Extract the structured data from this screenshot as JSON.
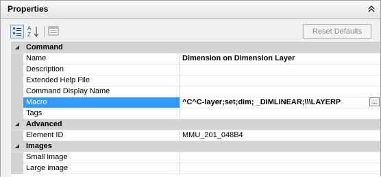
{
  "window": {
    "title": "Properties"
  },
  "toolbar": {
    "categorized_label": "Categorized",
    "alphabetical_label": "Alphabetical",
    "property_pages_label": "Property Pages",
    "reset_label": "Reset Defaults"
  },
  "categories": [
    {
      "label": "Command",
      "rows": [
        {
          "name": "Name",
          "value": "Dimension on Dimension Layer"
        },
        {
          "name": "Description",
          "value": ""
        },
        {
          "name": "Extended Help File",
          "value": ""
        },
        {
          "name": "Command Display Name",
          "value": ""
        },
        {
          "name": "Macro",
          "value": "^C^C-layer;set;dim; _DIMLINEAR;\\\\\\LAYERP"
        },
        {
          "name": "Tags",
          "value": ""
        }
      ]
    },
    {
      "label": "Advanced",
      "rows": [
        {
          "name": "Element ID",
          "value": "MMU_201_048B4"
        }
      ]
    },
    {
      "label": "Images",
      "rows": [
        {
          "name": "Small image",
          "value": ""
        },
        {
          "name": "Large image",
          "value": ""
        }
      ]
    }
  ],
  "ellipsis_label": "..."
}
